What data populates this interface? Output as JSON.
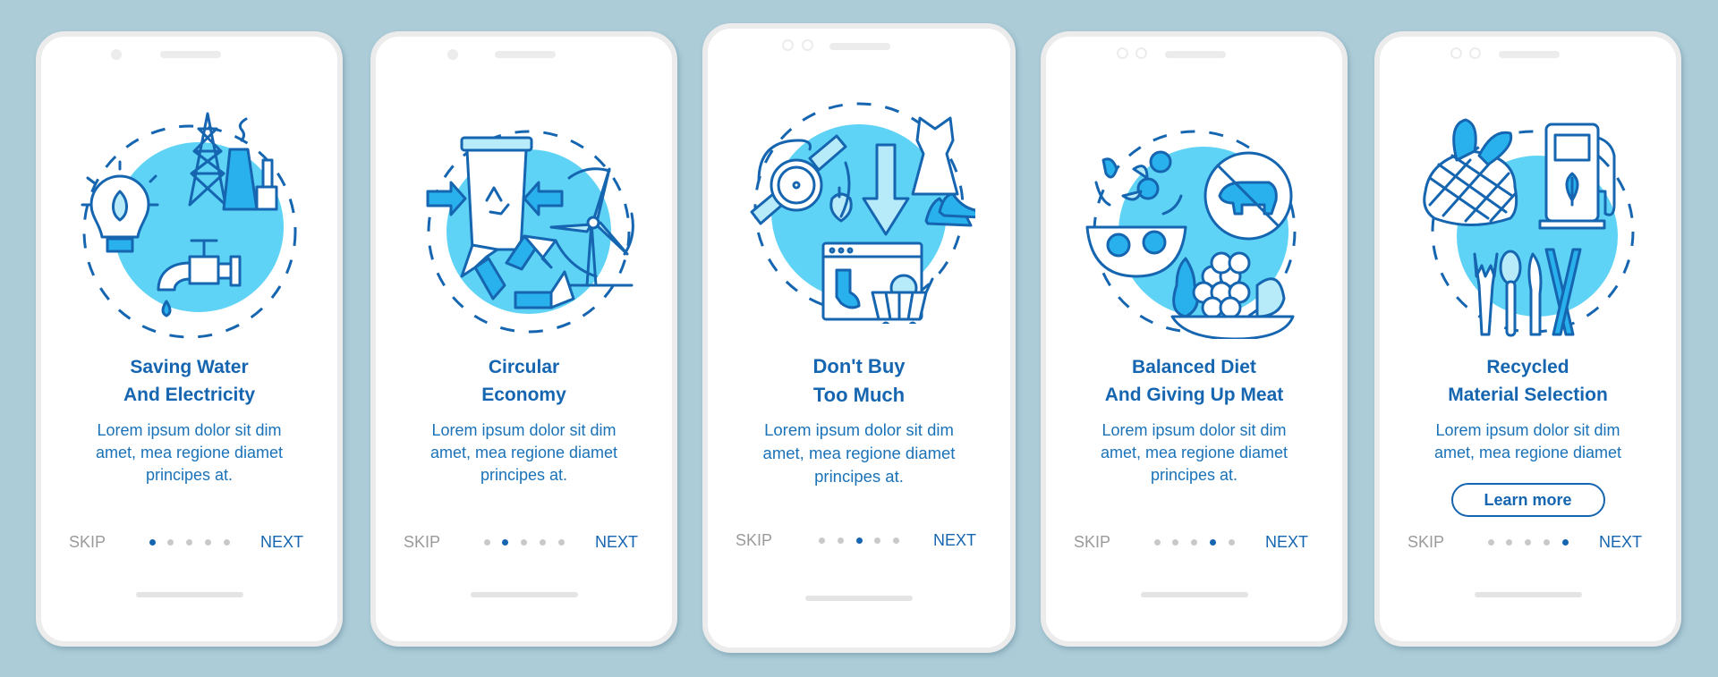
{
  "colors": {
    "background": "#acccd8",
    "accent": "#1565b0",
    "illustration_fill": "#5fd3f6",
    "inactive_dot": "#c9c9c9",
    "skip_text": "#9a9a9a"
  },
  "screens": [
    {
      "title_line1": "Saving Water",
      "title_line2": "And Electricity",
      "desc_line1": "Lorem ipsum dolor sit dim",
      "desc_line2": "amet, mea regione diamet",
      "desc_line3": "principes at.",
      "illustration": "water-electricity-illustration",
      "skip_label": "SKIP",
      "next_label": "NEXT",
      "active_page": 1,
      "total_pages": 5
    },
    {
      "title_line1": "Circular",
      "title_line2": "Economy",
      "desc_line1": "Lorem ipsum dolor sit dim",
      "desc_line2": "amet, mea regione diamet",
      "desc_line3": "principes at.",
      "illustration": "circular-economy-illustration",
      "skip_label": "SKIP",
      "next_label": "NEXT",
      "active_page": 2,
      "total_pages": 5
    },
    {
      "title_line1": "Don't Buy",
      "title_line2": "Too Much",
      "desc_line1": "Lorem ipsum dolor sit dim",
      "desc_line2": "amet, mea regione diamet",
      "desc_line3": "principes at.",
      "illustration": "dont-buy-too-much-illustration",
      "skip_label": "SKIP",
      "next_label": "NEXT",
      "active_page": 3,
      "total_pages": 5
    },
    {
      "title_line1": "Balanced Diet",
      "title_line2": "And Giving Up Meat",
      "desc_line1": "Lorem ipsum dolor sit dim",
      "desc_line2": "amet, mea regione diamet",
      "desc_line3": "principes at.",
      "illustration": "balanced-diet-illustration",
      "skip_label": "SKIP",
      "next_label": "NEXT",
      "active_page": 4,
      "total_pages": 5
    },
    {
      "title_line1": "Recycled",
      "title_line2": "Material Selection",
      "desc_line1": "Lorem ipsum dolor sit dim",
      "desc_line2": "amet, mea regione diamet",
      "illustration": "recycled-material-illustration",
      "button_label": "Learn more",
      "skip_label": "SKIP",
      "next_label": "NEXT",
      "active_page": 5,
      "total_pages": 5
    }
  ]
}
